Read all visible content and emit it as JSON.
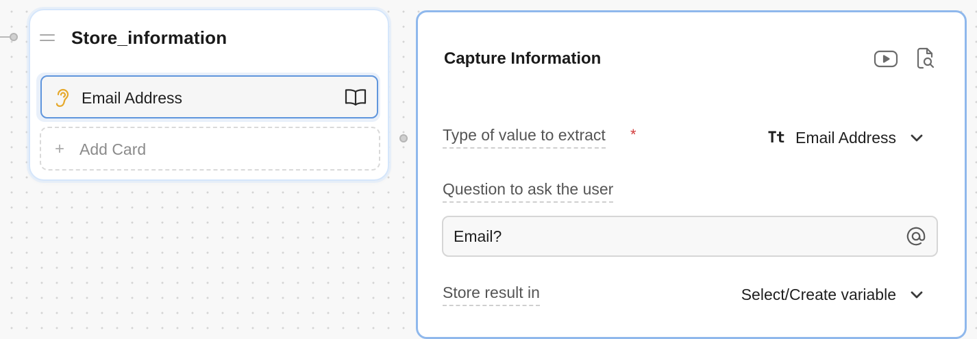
{
  "block": {
    "title": "Store_information",
    "cards": [
      {
        "label": "Email Address",
        "icon": "ear-icon",
        "action_icon": "book-icon"
      }
    ],
    "add_card_label": "Add Card"
  },
  "panel": {
    "title": "Capture Information",
    "header_icons": [
      "youtube-icon",
      "search-document-icon"
    ],
    "type_field": {
      "label": "Type of value to extract",
      "required": "*",
      "type_badge": "Tt",
      "value": "Email Address"
    },
    "question_field": {
      "label": "Question to ask the user",
      "value": "Email?"
    },
    "store_field": {
      "label": "Store result in",
      "value": "Select/Create variable"
    }
  },
  "colors": {
    "accent_border": "#5f95dc",
    "panel_border": "#8fb8ec",
    "ear_icon": "#e6a82a",
    "required": "#d23b3b"
  }
}
